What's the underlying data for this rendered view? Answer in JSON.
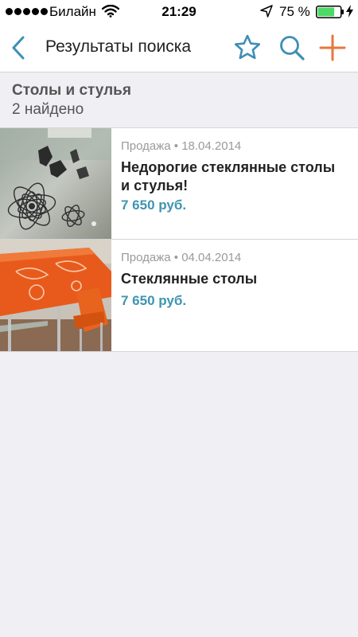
{
  "status_bar": {
    "carrier": "Билайн",
    "time": "21:29",
    "battery_percent": "75 %",
    "battery_level": 0.75,
    "signal_icon": "signal-dots",
    "wifi_icon": "wifi-icon",
    "location_icon": "location-arrow-icon",
    "charge_icon": "lightning-icon",
    "battery_color": "#4cd964"
  },
  "nav": {
    "title": "Результаты поиска",
    "back_icon": "chevron-left-icon",
    "favorite_icon": "star-icon",
    "search_icon": "search-icon",
    "add_icon": "plus-icon",
    "accent_color": "#3d8fb5",
    "add_color": "#e8773a"
  },
  "section": {
    "category": "Столы и стулья",
    "count": "2 найдено"
  },
  "listings": [
    {
      "meta": "Продажа • 18.04.2014",
      "title": "Недорогие стеклянные столы и стулья!",
      "price": "7 650 руб."
    },
    {
      "meta": "Продажа • 04.04.2014",
      "title": "Стеклянные столы",
      "price": "7 650 руб."
    }
  ],
  "colors": {
    "price": "#3d95b0",
    "background": "#efeff4"
  }
}
